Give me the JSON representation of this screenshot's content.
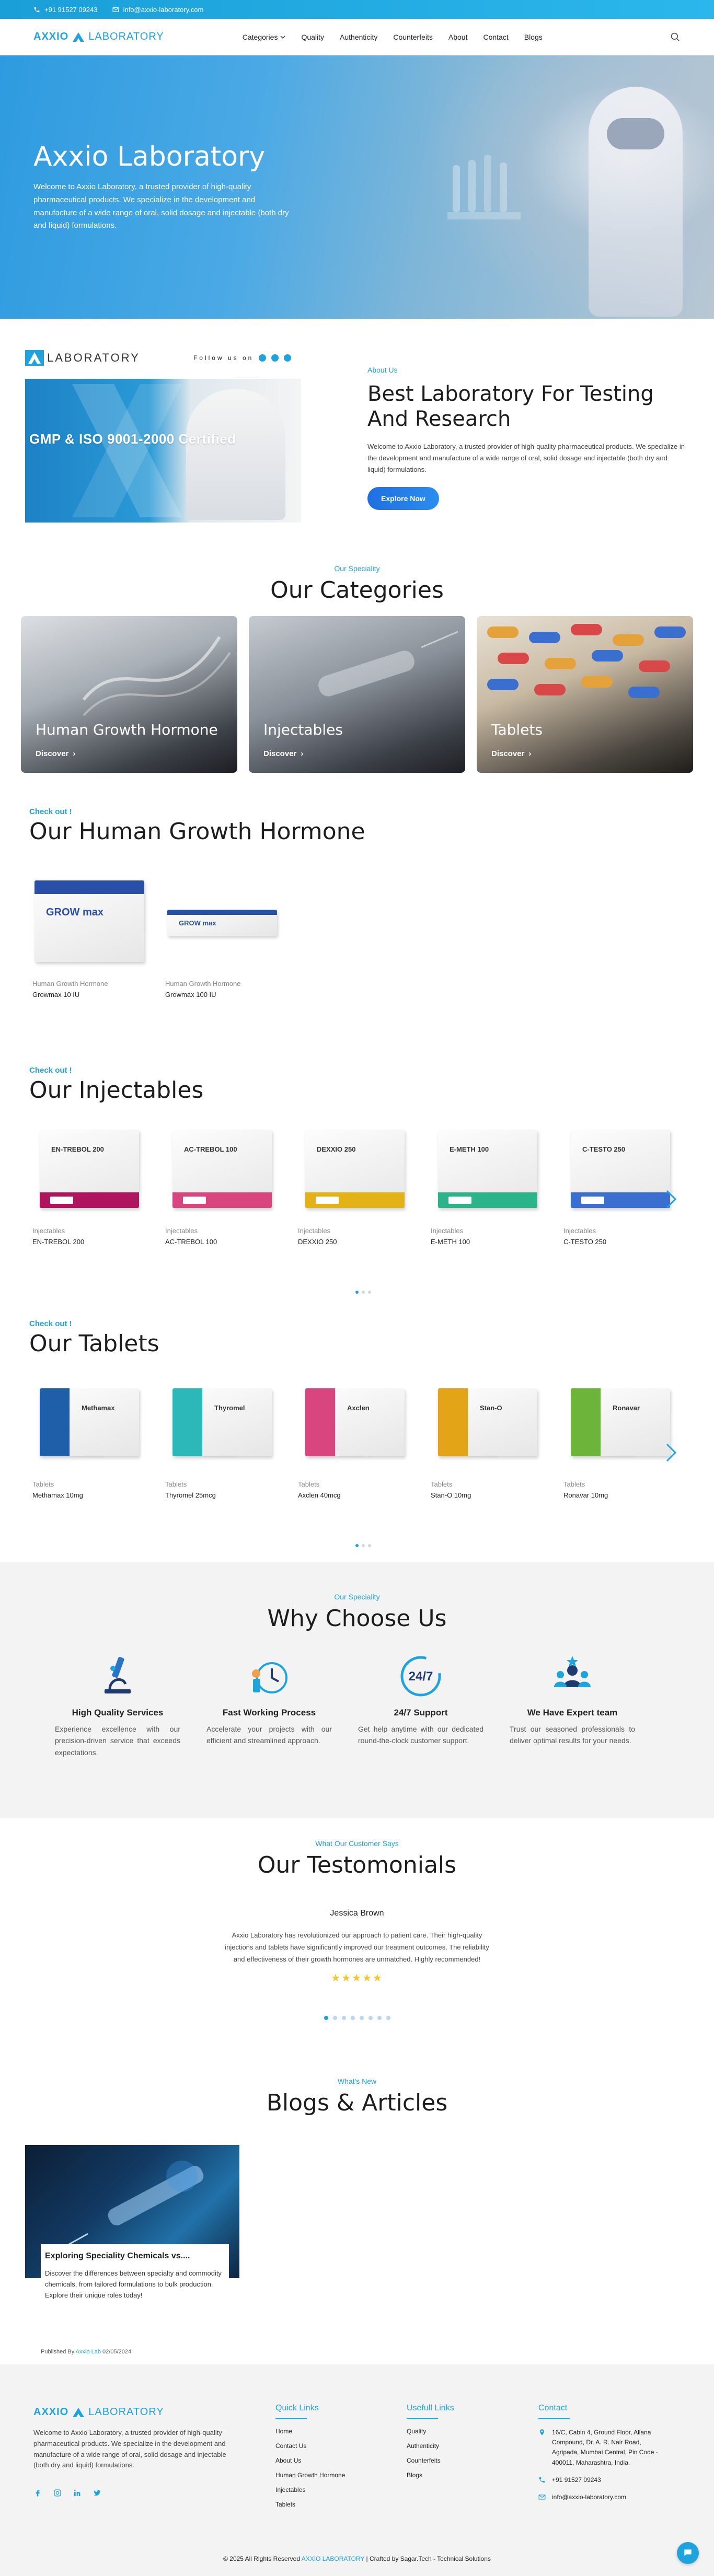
{
  "topbar": {
    "phone": "+91 91527 09243",
    "email": "info@axxio-laboratory.com"
  },
  "brand": {
    "name_primary": "AXXIO",
    "name_secondary": "LABORATORY"
  },
  "nav": {
    "items": [
      "Categories",
      "Quality",
      "Authenticity",
      "Counterfeits",
      "About",
      "Contact",
      "Blogs"
    ]
  },
  "hero": {
    "title": "Axxio Laboratory",
    "text": "Welcome to Axxio Laboratory, a trusted provider of high-quality pharmaceutical products. We specialize in the development and manufacture of a wide range of oral, solid dosage and injectable (both dry and liquid) formulations."
  },
  "about": {
    "lab_logo": "LABORATORY",
    "follow": "Follow us on",
    "badge": "GMP & ISO 9001-2000 Certified",
    "eyebrow": "About Us",
    "title": "Best Laboratory For Testing And Research",
    "text": "Welcome to Axxio Laboratory, a trusted provider of high-quality pharmaceutical products. We specialize in the development and manufacture of a wide range of oral, solid dosage and injectable (both dry and liquid) formulations.",
    "button": "Explore Now"
  },
  "categories": {
    "eyebrow": "Our Speciality",
    "title": "Our Categories",
    "items": [
      {
        "title": "Human Growth Hormone",
        "cta": "Discover"
      },
      {
        "title": "Injectables",
        "cta": "Discover"
      },
      {
        "title": "Tablets",
        "cta": "Discover"
      }
    ]
  },
  "hgh": {
    "checkout": "Check out !",
    "title": "Our Human Growth Hormone",
    "products": [
      {
        "category": "Human Growth Hormone",
        "name": "Growmax 10 IU",
        "box_label": "GROW max",
        "color": "#2a4fa8"
      },
      {
        "category": "Human Growth Hormone",
        "name": "Growmax 100 IU",
        "box_label": "GROW max",
        "color": "#2a4fa8"
      }
    ]
  },
  "injectables": {
    "checkout": "Check out !",
    "title": "Our Injectables",
    "products": [
      {
        "category": "Injectables",
        "name": "EN-TREBOL 200",
        "box_label": "EN-TREBOL 200",
        "color": "#b0145e"
      },
      {
        "category": "Injectables",
        "name": "AC-TREBOL 100",
        "box_label": "AC-TREBOL 100",
        "color": "#d9457e"
      },
      {
        "category": "Injectables",
        "name": "DEXXIO 250",
        "box_label": "DEXXIO 250",
        "color": "#e3b217"
      },
      {
        "category": "Injectables",
        "name": "E-METH 100",
        "box_label": "E-METH 100",
        "color": "#2bb38a"
      },
      {
        "category": "Injectables",
        "name": "C-TESTO 250",
        "box_label": "C-TESTO 250",
        "color": "#3a6fd0"
      }
    ]
  },
  "tablets": {
    "checkout": "Check out !",
    "title": "Our Tablets",
    "products": [
      {
        "category": "Tablets",
        "name": "Methamax 10mg",
        "box_label": "Methamax",
        "color": "#1f5ea8"
      },
      {
        "category": "Tablets",
        "name": "Thyromel 25mcg",
        "box_label": "Thyromel",
        "color": "#2cb8b8"
      },
      {
        "category": "Tablets",
        "name": "Axclen 40mcg",
        "box_label": "Axclen",
        "color": "#d9457e"
      },
      {
        "category": "Tablets",
        "name": "Stan-O 10mg",
        "box_label": "Stan-O",
        "color": "#e3a417"
      },
      {
        "category": "Tablets",
        "name": "Ronavar 10mg",
        "box_label": "Ronavar",
        "color": "#6cb43a"
      }
    ]
  },
  "why": {
    "eyebrow": "Our Speciality",
    "title": "Why Choose Us",
    "features": [
      {
        "title": "High Quality Services",
        "text": "Experience excellence with our precision-driven service that exceeds expectations."
      },
      {
        "title": "Fast Working Process",
        "text": "Accelerate your projects with our efficient and streamlined approach."
      },
      {
        "title": "24/7 Support",
        "text": "Get help anytime with our dedicated round-the-clock customer support.",
        "icon_text": "24/7"
      },
      {
        "title": "We Have Expert team",
        "text": "Trust our seasoned professionals to deliver optimal results for your needs."
      }
    ]
  },
  "testimonials": {
    "eyebrow": "What Our Customer Says",
    "title": "Our Testomonials",
    "name": "Jessica Brown",
    "quote": "Axxio Laboratory has revolutionized our approach to patient care. Their high-quality injections and tablets have significantly improved our treatment outcomes. The reliability and effectiveness of their growth hormones are unmatched. Highly recommended!",
    "stars": "★★★★★",
    "dot_count": 8
  },
  "blogs": {
    "eyebrow": "What's New",
    "title": "Blogs & Articles",
    "post": {
      "title": "Exploring Speciality Chemicals vs....",
      "excerpt": "Discover the differences between specialty and commodity chemicals, from tailored formulations to bulk production. Explore their unique roles today!",
      "published_by": "Published By",
      "author": "Axxio Lab",
      "date": "02/05/2024"
    }
  },
  "footer": {
    "about": "Welcome to Axxio Laboratory, a trusted provider of high-quality pharmaceutical products. We specialize in the development and manufacture of a wide range of oral, solid dosage and injectable (both dry and liquid) formulations.",
    "quick_links_title": "Quick Links",
    "quick_links": [
      "Home",
      "Contact Us",
      "About Us",
      "Human Growth Hormone",
      "Injectables",
      "Tablets"
    ],
    "useful_links_title": "Usefull Links",
    "useful_links": [
      "Quality",
      "Authenticity",
      "Counterfeits",
      "Blogs"
    ],
    "contact_title": "Contact",
    "address": "16/C, Cabin 4, Ground Floor, Allana Compound, Dr. A. R. Nair Road, Agripada, Mumbai Central, Pin Code - 400011, Maharashtra, India.",
    "phone": "+91 91527 09243",
    "email": "info@axxio-laboratory.com",
    "copyright": "© 2025 All Rights Reserved",
    "copyright_brand": "AXXIO LABORATORY",
    "credit": "| Crafted by Sagar.Tech - Technical Solutions"
  },
  "colors": {
    "accent": "#1fa3dd",
    "button": "#1f6fe0",
    "star": "#f3c62b"
  }
}
